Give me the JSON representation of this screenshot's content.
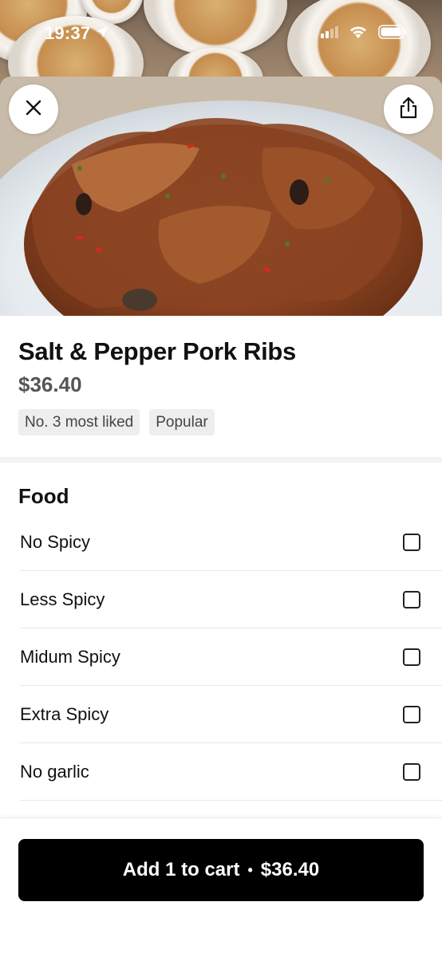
{
  "status_bar": {
    "time": "19:37",
    "icons": [
      "location-arrow-icon",
      "cellular-signal-icon",
      "wifi-icon",
      "battery-icon"
    ]
  },
  "hero": {
    "close_icon": "close-icon",
    "share_icon": "share-icon"
  },
  "item": {
    "title": "Salt & Pepper Pork Ribs",
    "price": "$36.40",
    "badges": [
      "No. 3 most liked",
      "Popular"
    ]
  },
  "options": {
    "section_title": "Food",
    "items": [
      {
        "label": "No Spicy",
        "checked": false
      },
      {
        "label": "Less Spicy",
        "checked": false
      },
      {
        "label": "Midum Spicy",
        "checked": false
      },
      {
        "label": "Extra Spicy",
        "checked": false
      },
      {
        "label": "No garlic",
        "checked": false
      }
    ]
  },
  "cart_button": {
    "label": "Add 1 to cart",
    "separator": "•",
    "price": "$36.40"
  },
  "colors": {
    "button_bg": "#000000",
    "badge_bg": "#eeeeee",
    "divider": "#f3f3f3"
  }
}
